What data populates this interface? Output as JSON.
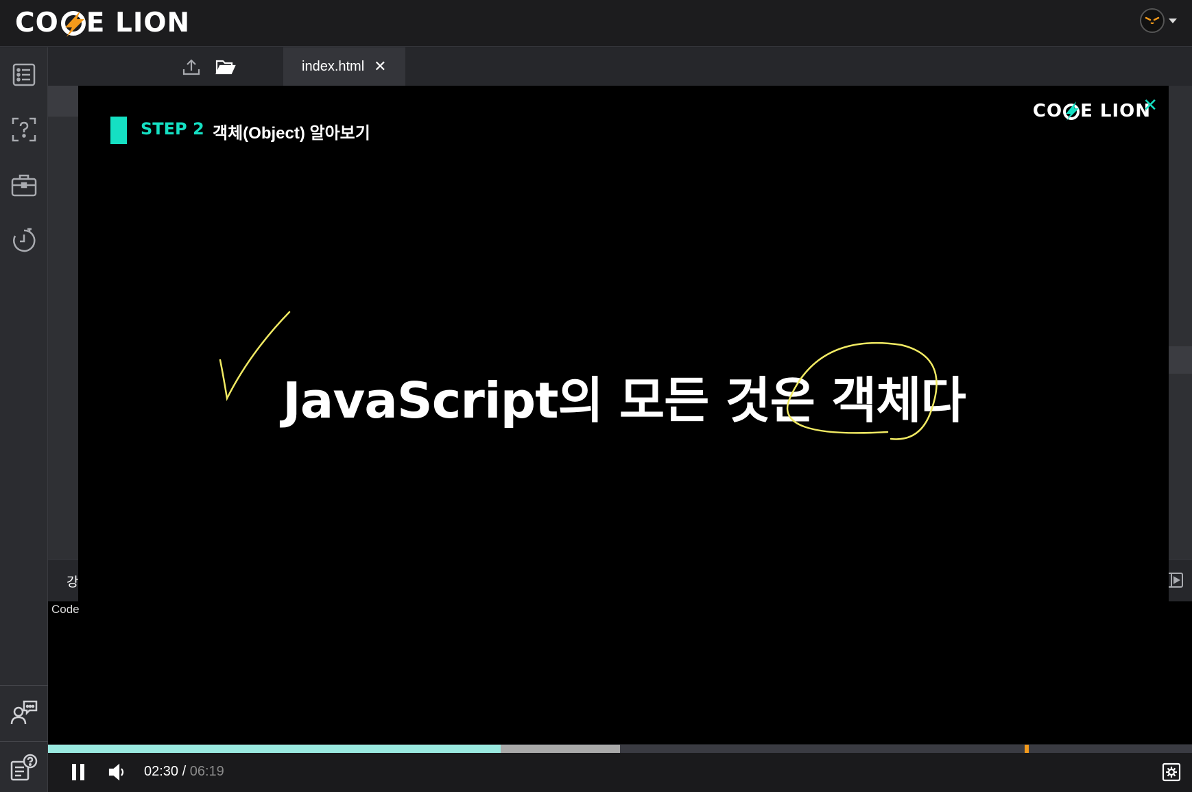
{
  "brand": {
    "left": "CO",
    "right": "E LION",
    "bolt_color": "#f39a1b"
  },
  "sidebar": {
    "items": [
      {
        "icon": "list-icon"
      },
      {
        "icon": "question-icon"
      },
      {
        "icon": "briefcase-icon"
      },
      {
        "icon": "timer-icon"
      }
    ],
    "bottom": [
      {
        "icon": "user-chat-icon"
      },
      {
        "icon": "help-doc-icon"
      }
    ]
  },
  "editor": {
    "upload_icon": "upload-icon",
    "folder_icon": "folder-icon",
    "tab_name": "index.html",
    "tab_close": "✕"
  },
  "video": {
    "step_label": "STEP 2",
    "step_title": "객체(Object) 알아보기",
    "brand_left": "CO",
    "brand_right": "E LION",
    "close_glyph": "✕",
    "headline": "JavaScript의 모든 것은 객체다",
    "accent": "#15e0c3",
    "annotation_color": "#f1ea63"
  },
  "lecture": {
    "label": "강",
    "code_label": "Code"
  },
  "player": {
    "current_time": "02:30",
    "separator": " / ",
    "duration": "06:19",
    "played_fraction": 0.3956,
    "buffered_fraction": 0.5,
    "marker_fraction": 0.8535
  }
}
